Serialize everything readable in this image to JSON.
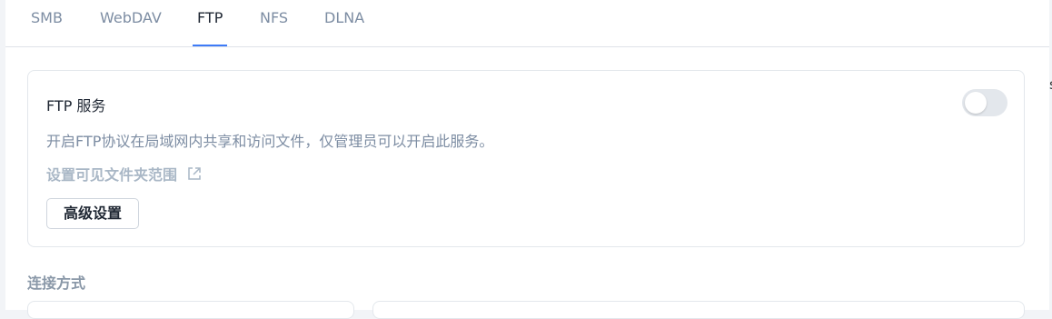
{
  "tabs": [
    {
      "label": "SMB",
      "active": false
    },
    {
      "label": "WebDAV",
      "active": false
    },
    {
      "label": "FTP",
      "active": true
    },
    {
      "label": "NFS",
      "active": false
    },
    {
      "label": "DLNA",
      "active": false
    }
  ],
  "ftp_service": {
    "title": "FTP 服务",
    "enabled": false,
    "description": "开启FTP协议在局域网内共享和访问文件，仅管理员可以开启此服务。",
    "link_label": "设置可见文件夹范围",
    "link_icon": "external-link-icon",
    "advanced_button": "高级设置"
  },
  "connection": {
    "title": "连接方式"
  },
  "side_fragment": "s",
  "colors": {
    "accent": "#3e7bf7",
    "text_primary": "#1f2733",
    "text_secondary": "#7d8da3",
    "link_disabled": "#a9b7c6",
    "toggle_off": "#e3e7ec"
  }
}
